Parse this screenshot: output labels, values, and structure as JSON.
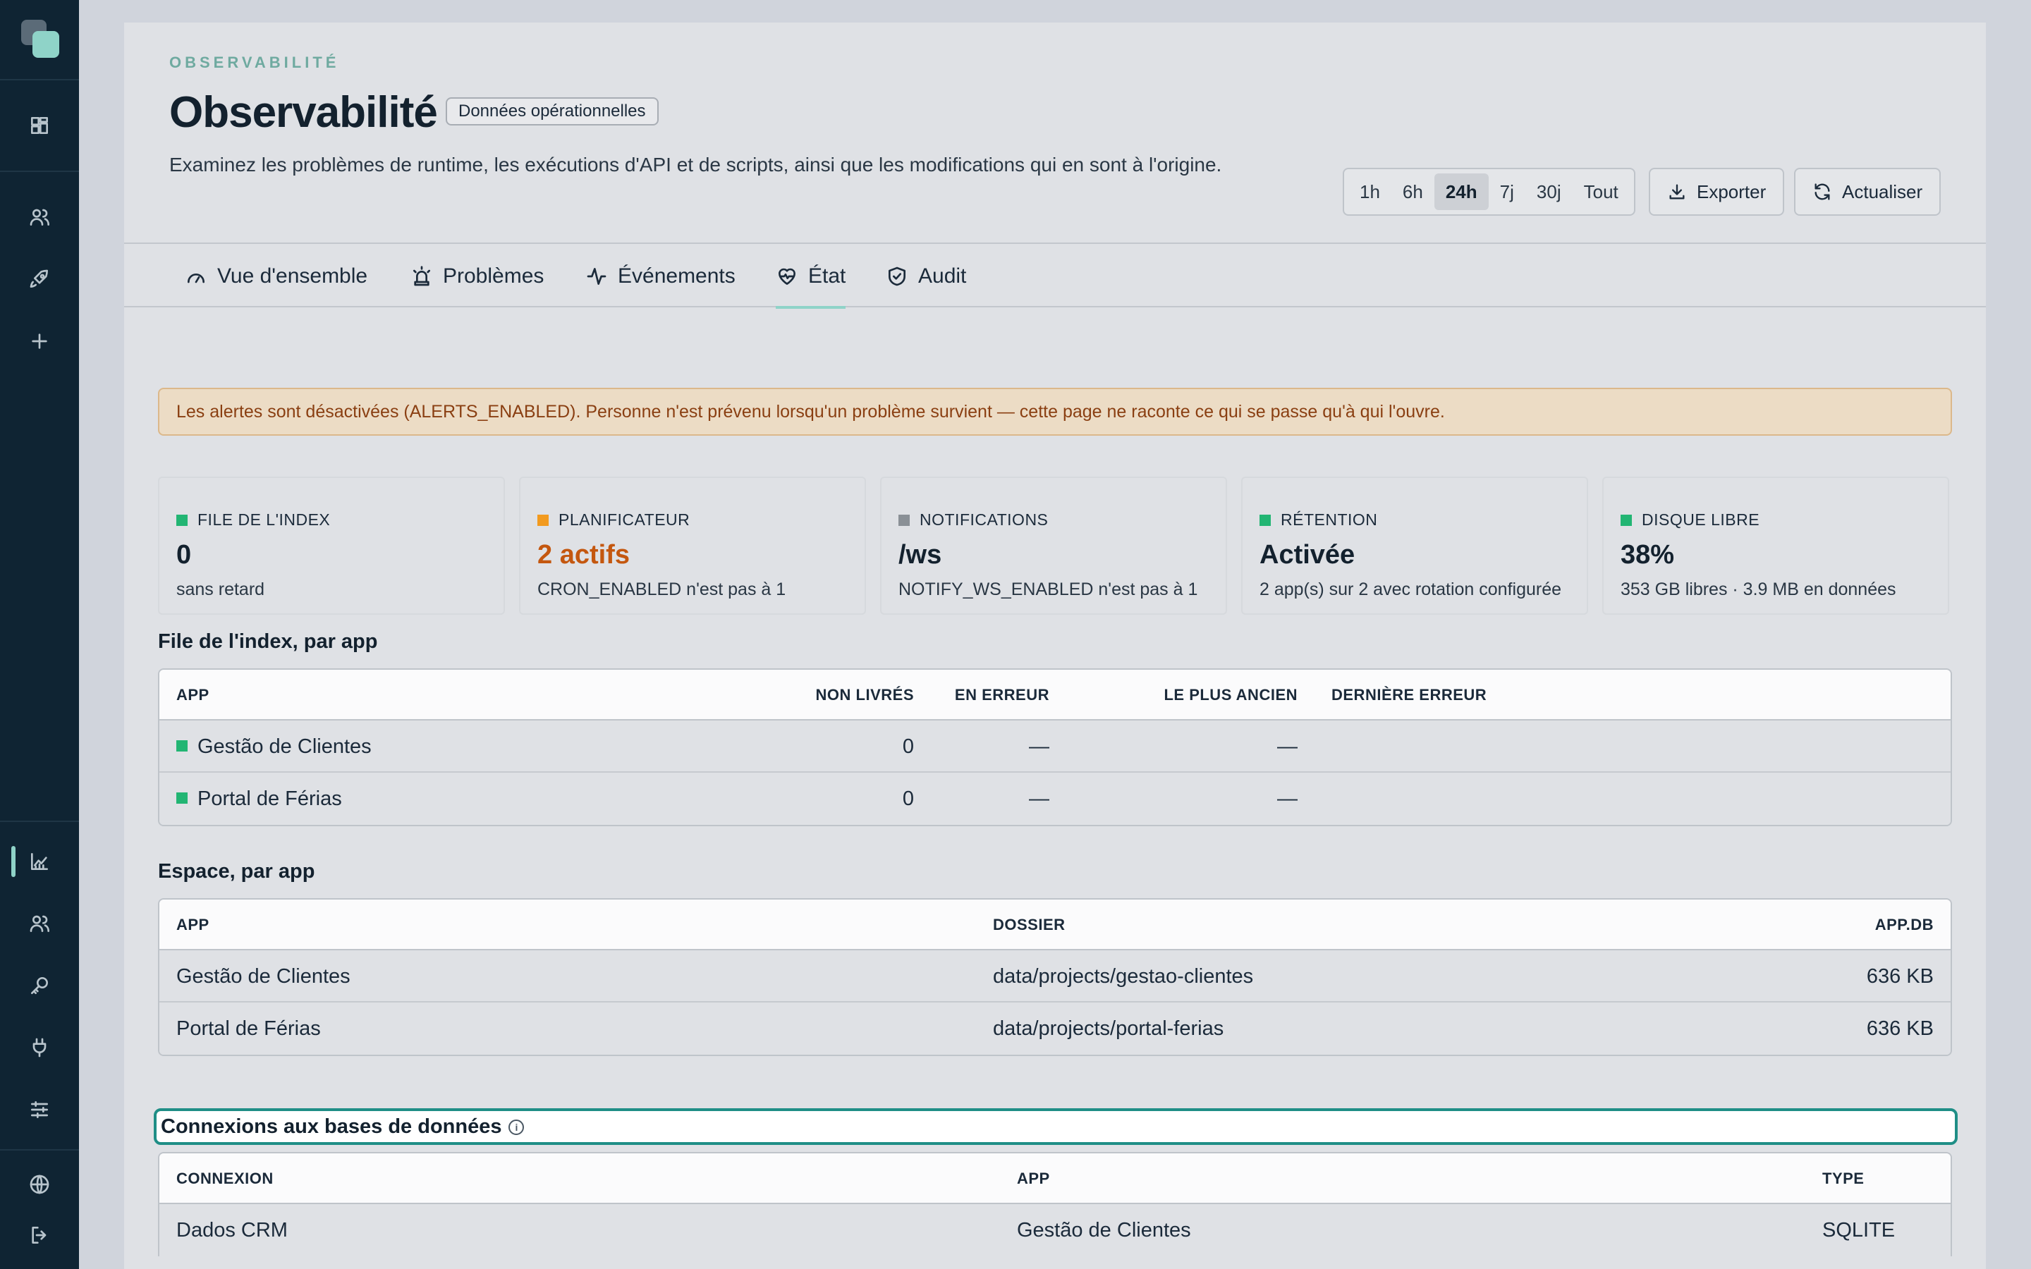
{
  "header": {
    "eyebrow": "OBSERVABILITÉ",
    "title": "Observabilité",
    "badge": "Données opérationnelles",
    "subtitle": "Examinez les problèmes de runtime, les exécutions d'API et de scripts, ainsi que les modifications qui en sont à l'origine.",
    "ranges": [
      "1h",
      "6h",
      "24h",
      "7j",
      "30j",
      "Tout"
    ],
    "active_range": "24h",
    "export_label": "Exporter",
    "refresh_label": "Actualiser"
  },
  "tabs": [
    {
      "label": "Vue d'ensemble",
      "icon": "gauge-icon"
    },
    {
      "label": "Problèmes",
      "icon": "siren-icon"
    },
    {
      "label": "Événements",
      "icon": "activity-icon"
    },
    {
      "label": "État",
      "icon": "heart-pulse-icon",
      "active": true
    },
    {
      "label": "Audit",
      "icon": "shield-check-icon"
    }
  ],
  "alert": "Les alertes sont désactivées (ALERTS_ENABLED). Personne n'est prévenu lorsqu'un problème survient — cette page ne raconte ce qui se passe qu'à qui l'ouvre.",
  "stats": [
    {
      "label": "FILE DE L'INDEX",
      "value": "0",
      "sub": "sans retard",
      "color": "#22b573",
      "value_color": "#13212e"
    },
    {
      "label": "PLANIFICATEUR",
      "value": "2 actifs",
      "sub": "CRON_ENABLED n'est pas à 1",
      "color": "#f29a1f",
      "value_color": "#c4570f"
    },
    {
      "label": "NOTIFICATIONS",
      "value": "/ws",
      "sub": "NOTIFY_WS_ENABLED n'est pas à 1",
      "color": "#8a9096",
      "value_color": "#13212e"
    },
    {
      "label": "RÉTENTION",
      "value": "Activée",
      "sub": "2 app(s) sur 2 avec rotation configurée",
      "color": "#22b573",
      "value_color": "#13212e"
    },
    {
      "label": "DISQUE LIBRE",
      "value": "38%",
      "sub": "353 GB libres · 3.9 MB en données",
      "color": "#22b573",
      "value_color": "#13212e"
    }
  ],
  "index_queue": {
    "title": "File de l'index, par app",
    "headers": [
      "APP",
      "NON LIVRÉS",
      "EN ERREUR",
      "LE PLUS ANCIEN",
      "DERNIÈRE ERREUR"
    ],
    "rows": [
      {
        "app": "Gestão de Clientes",
        "undelivered": "0",
        "errors": "—",
        "oldest": "—",
        "last_error": ""
      },
      {
        "app": "Portal de Férias",
        "undelivered": "0",
        "errors": "—",
        "oldest": "—",
        "last_error": ""
      }
    ]
  },
  "space": {
    "title": "Espace, par app",
    "headers": [
      "APP",
      "DOSSIER",
      "APP.DB"
    ],
    "rows": [
      {
        "app": "Gestão de Clientes",
        "folder": "data/projects/gestao-clientes",
        "size": "636 KB"
      },
      {
        "app": "Portal de Férias",
        "folder": "data/projects/portal-ferias",
        "size": "636 KB"
      }
    ]
  },
  "connections": {
    "title": "Connexions aux bases de données",
    "info_glyph": "i",
    "headers": [
      "CONNEXION",
      "APP",
      "TYPE"
    ],
    "rows": [
      {
        "name": "Dados CRM",
        "app": "Gestão de Clientes",
        "type": "SQLITE"
      }
    ]
  }
}
